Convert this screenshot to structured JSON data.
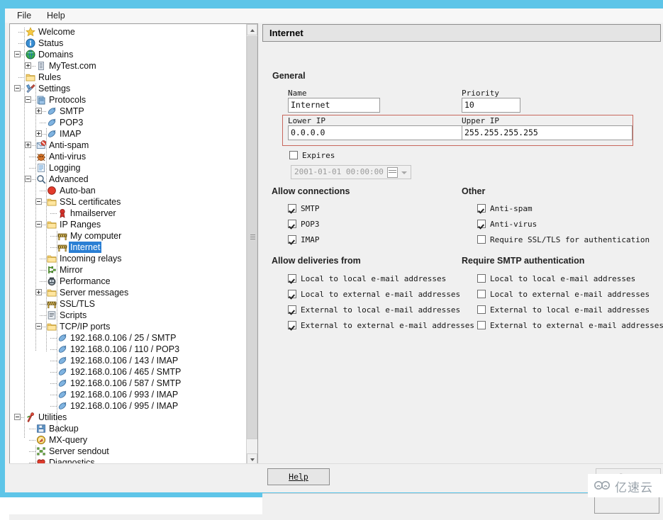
{
  "window": {
    "title": "",
    "frame_color": "#5ec5e8"
  },
  "menubar": {
    "items": [
      {
        "label": "File"
      },
      {
        "label": "Help"
      }
    ]
  },
  "tree": {
    "selected": "Internet",
    "items": [
      {
        "label": "Welcome",
        "indent": 1,
        "icon": "star-icon",
        "expander": "none"
      },
      {
        "label": "Status",
        "indent": 1,
        "icon": "info-icon",
        "expander": "none"
      },
      {
        "label": "Domains",
        "indent": 1,
        "icon": "globe-icon",
        "expander": "minus"
      },
      {
        "label": "MyTest.com",
        "indent": 2,
        "icon": "server-icon",
        "expander": "plus"
      },
      {
        "label": "Rules",
        "indent": 1,
        "icon": "folder-icon",
        "expander": "none"
      },
      {
        "label": "Settings",
        "indent": 1,
        "icon": "tools-icon",
        "expander": "minus"
      },
      {
        "label": "Protocols",
        "indent": 2,
        "icon": "protocols-icon",
        "expander": "minus"
      },
      {
        "label": "SMTP",
        "indent": 3,
        "icon": "plug-icon",
        "expander": "plus"
      },
      {
        "label": "POP3",
        "indent": 3,
        "icon": "plug-icon",
        "expander": "none"
      },
      {
        "label": "IMAP",
        "indent": 3,
        "icon": "plug-icon",
        "expander": "plus"
      },
      {
        "label": "Anti-spam",
        "indent": 2,
        "icon": "antispam-icon",
        "expander": "plus"
      },
      {
        "label": "Anti-virus",
        "indent": 2,
        "icon": "antivirus-icon",
        "expander": "none"
      },
      {
        "label": "Logging",
        "indent": 2,
        "icon": "log-icon",
        "expander": "none"
      },
      {
        "label": "Advanced",
        "indent": 2,
        "icon": "magnifier-icon",
        "expander": "minus"
      },
      {
        "label": "Auto-ban",
        "indent": 3,
        "icon": "stop-icon",
        "expander": "none"
      },
      {
        "label": "SSL certificates",
        "indent": 3,
        "icon": "folder-icon",
        "expander": "minus"
      },
      {
        "label": "hmailserver",
        "indent": 4,
        "icon": "certificate-icon",
        "expander": "none"
      },
      {
        "label": "IP Ranges",
        "indent": 3,
        "icon": "folder-icon",
        "expander": "minus"
      },
      {
        "label": "My computer",
        "indent": 4,
        "icon": "barrier-icon",
        "expander": "none"
      },
      {
        "label": "Internet",
        "indent": 4,
        "icon": "barrier-icon",
        "expander": "none",
        "selected": true
      },
      {
        "label": "Incoming relays",
        "indent": 3,
        "icon": "folder-icon",
        "expander": "none"
      },
      {
        "label": "Mirror",
        "indent": 3,
        "icon": "mirror-icon",
        "expander": "none"
      },
      {
        "label": "Performance",
        "indent": 3,
        "icon": "performance-icon",
        "expander": "none"
      },
      {
        "label": "Server messages",
        "indent": 3,
        "icon": "folder-icon",
        "expander": "plus"
      },
      {
        "label": "SSL/TLS",
        "indent": 3,
        "icon": "barrier-icon",
        "expander": "none"
      },
      {
        "label": "Scripts",
        "indent": 3,
        "icon": "script-icon",
        "expander": "none"
      },
      {
        "label": "TCP/IP ports",
        "indent": 3,
        "icon": "folder-icon",
        "expander": "minus"
      },
      {
        "label": "192.168.0.106 / 25 / SMTP",
        "indent": 4,
        "icon": "plug-icon",
        "expander": "none"
      },
      {
        "label": "192.168.0.106 / 110 / POP3",
        "indent": 4,
        "icon": "plug-icon",
        "expander": "none"
      },
      {
        "label": "192.168.0.106 / 143 / IMAP",
        "indent": 4,
        "icon": "plug-icon",
        "expander": "none"
      },
      {
        "label": "192.168.0.106 / 465 / SMTP",
        "indent": 4,
        "icon": "plug-icon",
        "expander": "none"
      },
      {
        "label": "192.168.0.106 / 587 / SMTP",
        "indent": 4,
        "icon": "plug-icon",
        "expander": "none"
      },
      {
        "label": "192.168.0.106 / 993 / IMAP",
        "indent": 4,
        "icon": "plug-icon",
        "expander": "none"
      },
      {
        "label": "192.168.0.106 / 995 / IMAP",
        "indent": 4,
        "icon": "plug-icon",
        "expander": "none"
      },
      {
        "label": "Utilities",
        "indent": 1,
        "icon": "utilities-icon",
        "expander": "minus"
      },
      {
        "label": "Backup",
        "indent": 2,
        "icon": "backup-icon",
        "expander": "none"
      },
      {
        "label": "MX-query",
        "indent": 2,
        "icon": "mxquery-icon",
        "expander": "none"
      },
      {
        "label": "Server sendout",
        "indent": 2,
        "icon": "sendout-icon",
        "expander": "none"
      },
      {
        "label": "Diagnostics",
        "indent": 2,
        "icon": "heart-icon",
        "expander": "none"
      }
    ]
  },
  "panel": {
    "title": "Internet",
    "general": {
      "heading": "General",
      "name_label": "Name",
      "name_value": "Internet",
      "priority_label": "Priority",
      "priority_value": "10",
      "lower_ip_label": "Lower IP",
      "lower_ip_value": "0.0.0.0",
      "upper_ip_label": "Upper IP",
      "upper_ip_value": "255.255.255.255",
      "expires_label": "Expires",
      "expires_checked": false,
      "expires_date": "2001-01-01 00:00:00",
      "highlight_color": "#c8675c"
    },
    "allow_connections": {
      "heading": "Allow connections",
      "items": [
        {
          "label": "SMTP",
          "checked": true
        },
        {
          "label": "POP3",
          "checked": true
        },
        {
          "label": "IMAP",
          "checked": true
        }
      ]
    },
    "other": {
      "heading": "Other",
      "items": [
        {
          "label": "Anti-spam",
          "checked": true
        },
        {
          "label": "Anti-virus",
          "checked": true
        },
        {
          "label": "Require SSL/TLS for authentication",
          "checked": false
        }
      ]
    },
    "allow_deliveries_from": {
      "heading": "Allow deliveries from",
      "items": [
        {
          "label": "Local to local e-mail addresses",
          "checked": true
        },
        {
          "label": "Local to external e-mail addresses",
          "checked": true
        },
        {
          "label": "External to local e-mail addresses",
          "checked": true
        },
        {
          "label": "External to external e-mail addresses",
          "checked": true
        }
      ]
    },
    "require_smtp_authentication": {
      "heading": "Require SMTP authentication",
      "items": [
        {
          "label": "Local to local e-mail addresses",
          "checked": false
        },
        {
          "label": "Local to external e-mail addresses",
          "checked": false
        },
        {
          "label": "External to local e-mail addresses",
          "checked": false
        },
        {
          "label": "External to external e-mail addresses",
          "checked": false
        }
      ]
    }
  },
  "buttons": {
    "help": "Help",
    "save": "Save",
    "save_enabled": false
  },
  "watermark": {
    "text": "亿速云"
  }
}
